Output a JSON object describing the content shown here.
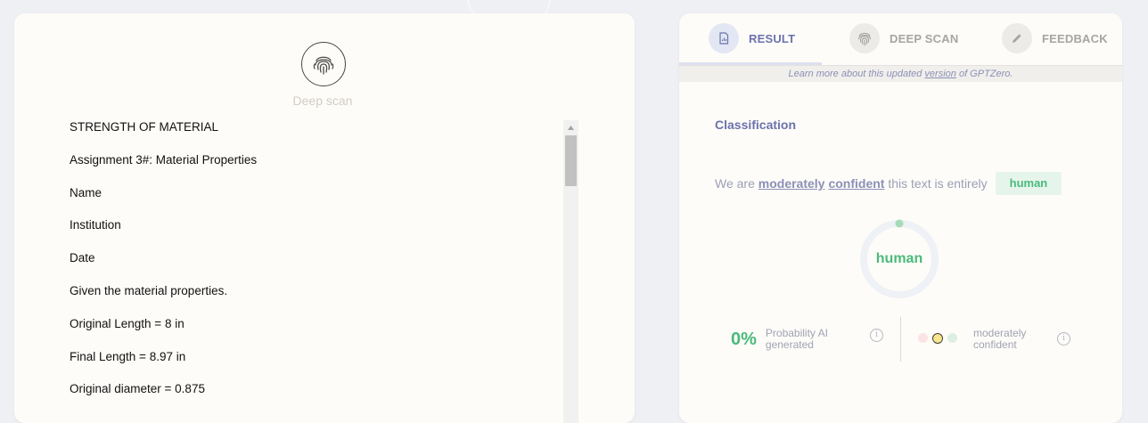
{
  "left_panel": {
    "deep_scan_label": "Deep scan",
    "document_lines": [
      "STRENGTH OF MATERIAL",
      "Assignment 3#: Material Properties",
      "Name",
      "Institution",
      "Date",
      "Given the material properties.",
      "Original Length = 8 in",
      "Final Length = 8.97 in",
      "Original diameter = 0.875"
    ]
  },
  "right_panel": {
    "tabs": [
      {
        "label": "RESULT",
        "icon": "document-icon",
        "active": true
      },
      {
        "label": "DEEP SCAN",
        "icon": "fingerprint-icon",
        "active": false
      },
      {
        "label": "FEEDBACK",
        "icon": "pencil-icon",
        "active": false
      }
    ],
    "info_bar": {
      "prefix": "Learn more about this updated ",
      "link": "version",
      "suffix": " of GPTZero."
    },
    "classification": {
      "title": "Classification",
      "sentence_prefix": "We are ",
      "confidence_word1": "moderately",
      "confidence_word2": "confident",
      "sentence_suffix": " this text is entirely",
      "badge": "human",
      "donut_label": "human",
      "probability_value": "0%",
      "probability_label": "Probability AI generated",
      "confidence_label": "moderately confident",
      "active_level": "medium"
    }
  },
  "colors": {
    "accent": "#6b72ad",
    "human_green": "#4aba7c",
    "donut_track": "#eef1f5",
    "dot_low": "#fde4e4",
    "dot_medium": "#f8e58c",
    "dot_high": "#dcefe2"
  }
}
